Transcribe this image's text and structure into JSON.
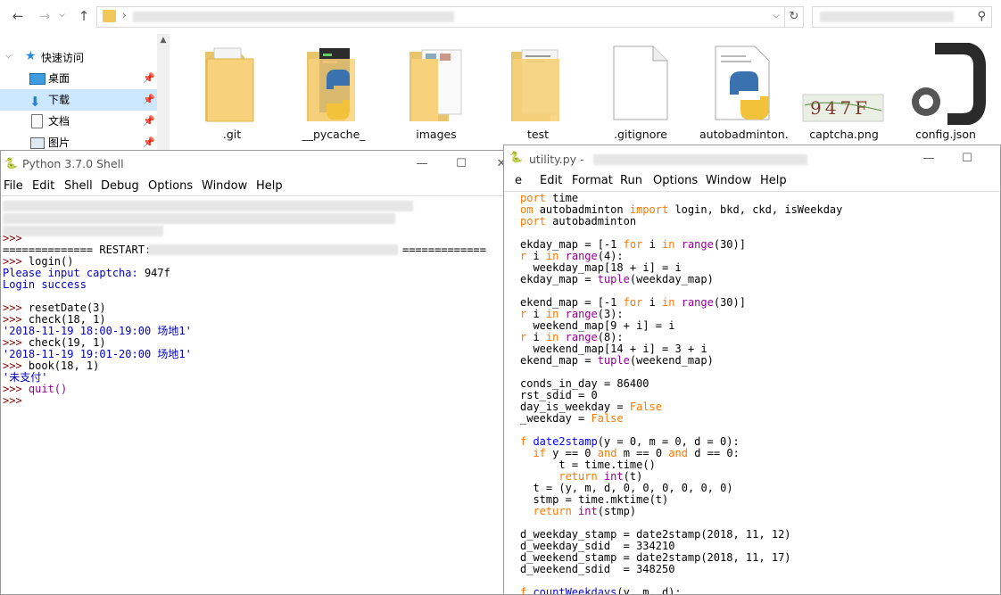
{
  "explorer": {
    "nav_buttons": {
      "back": "←",
      "forward": "→",
      "up": "↑"
    },
    "nav_pane": {
      "quick_access_label": "快速访问",
      "items": [
        {
          "label": "桌面",
          "icon": "desktop-icon"
        },
        {
          "label": "下载",
          "icon": "download-icon"
        },
        {
          "label": "文档",
          "icon": "document-icon"
        },
        {
          "label": "图片",
          "icon": "pictures-icon"
        }
      ]
    },
    "files": [
      {
        "name": ".git",
        "icon": "folder-icon"
      },
      {
        "name": "__pycache_",
        "icon": "folder-python-icon"
      },
      {
        "name": "images",
        "icon": "folder-images-icon"
      },
      {
        "name": "test",
        "icon": "folder-test-icon"
      },
      {
        "name": ".gitignore",
        "icon": "blank-file-icon"
      },
      {
        "name": "autobadminton.",
        "icon": "python-file-icon"
      },
      {
        "name": "captcha.png",
        "icon": "image-file-icon",
        "captcha_text": "947F"
      },
      {
        "name": "config.json",
        "icon": "json-file-icon"
      }
    ]
  },
  "shell": {
    "title": "Python 3.7.0 Shell",
    "menu": [
      "File",
      "Edit",
      "Shell",
      "Debug",
      "Options",
      "Window",
      "Help"
    ],
    "lines": {
      "p0": ">>>",
      "restart_left": "============== RESTART:",
      "restart_right": "=============",
      "l1_prompt": ">>> ",
      "l1_code": "login()",
      "l2": "Please input captcha: ",
      "l2_val": "947f",
      "l3": "Login success",
      "l4_prompt": ">>> ",
      "l4_code": "resetDate(3)",
      "l5_prompt": ">>> ",
      "l5_code": "check(18, 1)",
      "l6": "'2018-11-19 18:00-19:00 场地1'",
      "l7_prompt": ">>> ",
      "l7_code": "check(19, 1)",
      "l8": "'2018-11-19 19:01-20:00 场地1'",
      "l9_prompt": ">>> ",
      "l9_code": "book(18, 1)",
      "l10": "'未支付'",
      "l11_prompt": ">>> ",
      "l11_code": "quit()",
      "l12_prompt": ">>>"
    }
  },
  "editor": {
    "title": "utility.py -",
    "menu": [
      "e",
      "Edit",
      "Format",
      "Run",
      "Options",
      "Window",
      "Help"
    ],
    "code_lines": [
      "port time",
      "om autobadminton import login, bkd, ckd, isWeekday",
      "port autobadminton",
      "",
      "ekday_map = [-1 for i in range(30)]",
      "r i in range(4):",
      "  weekday_map[18 + i] = i",
      "ekday_map = tuple(weekday_map)",
      "",
      "ekend_map = [-1 for i in range(30)]",
      "r i in range(3):",
      "  weekend_map[9 + i] = i",
      "r i in range(8):",
      "  weekend_map[14 + i] = 3 + i",
      "ekend_map = tuple(weekend_map)",
      "",
      "conds_in_day = 86400",
      "rst_sdid = 0",
      "day_is_weekday = False",
      "_weekday = False",
      "",
      "f date2stamp(y = 0, m = 0, d = 0):",
      "  if y == 0 and m == 0 and d == 0:",
      "      t = time.time()",
      "      return int(t)",
      "  t = (y, m, d, 0, 0, 0, 0, 0, 0)",
      "  stmp = time.mktime(t)",
      "  return int(stmp)",
      "",
      "d_weekday_stamp = date2stamp(2018, 11, 12)",
      "d_weekday_sdid  = 334210",
      "d_weekend_stamp = date2stamp(2018, 11, 17)",
      "d_weekend_sdid  = 348250",
      "",
      "f countWeekdays(y, m, d):"
    ]
  }
}
